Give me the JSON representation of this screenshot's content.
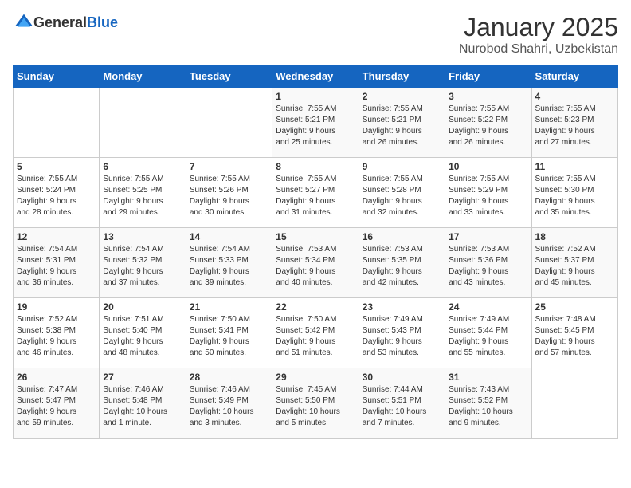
{
  "logo": {
    "general": "General",
    "blue": "Blue"
  },
  "title": "January 2025",
  "subtitle": "Nurobod Shahri, Uzbekistan",
  "headers": [
    "Sunday",
    "Monday",
    "Tuesday",
    "Wednesday",
    "Thursday",
    "Friday",
    "Saturday"
  ],
  "weeks": [
    [
      {
        "day": "",
        "info": ""
      },
      {
        "day": "",
        "info": ""
      },
      {
        "day": "",
        "info": ""
      },
      {
        "day": "1",
        "info": "Sunrise: 7:55 AM\nSunset: 5:21 PM\nDaylight: 9 hours\nand 25 minutes."
      },
      {
        "day": "2",
        "info": "Sunrise: 7:55 AM\nSunset: 5:21 PM\nDaylight: 9 hours\nand 26 minutes."
      },
      {
        "day": "3",
        "info": "Sunrise: 7:55 AM\nSunset: 5:22 PM\nDaylight: 9 hours\nand 26 minutes."
      },
      {
        "day": "4",
        "info": "Sunrise: 7:55 AM\nSunset: 5:23 PM\nDaylight: 9 hours\nand 27 minutes."
      }
    ],
    [
      {
        "day": "5",
        "info": "Sunrise: 7:55 AM\nSunset: 5:24 PM\nDaylight: 9 hours\nand 28 minutes."
      },
      {
        "day": "6",
        "info": "Sunrise: 7:55 AM\nSunset: 5:25 PM\nDaylight: 9 hours\nand 29 minutes."
      },
      {
        "day": "7",
        "info": "Sunrise: 7:55 AM\nSunset: 5:26 PM\nDaylight: 9 hours\nand 30 minutes."
      },
      {
        "day": "8",
        "info": "Sunrise: 7:55 AM\nSunset: 5:27 PM\nDaylight: 9 hours\nand 31 minutes."
      },
      {
        "day": "9",
        "info": "Sunrise: 7:55 AM\nSunset: 5:28 PM\nDaylight: 9 hours\nand 32 minutes."
      },
      {
        "day": "10",
        "info": "Sunrise: 7:55 AM\nSunset: 5:29 PM\nDaylight: 9 hours\nand 33 minutes."
      },
      {
        "day": "11",
        "info": "Sunrise: 7:55 AM\nSunset: 5:30 PM\nDaylight: 9 hours\nand 35 minutes."
      }
    ],
    [
      {
        "day": "12",
        "info": "Sunrise: 7:54 AM\nSunset: 5:31 PM\nDaylight: 9 hours\nand 36 minutes."
      },
      {
        "day": "13",
        "info": "Sunrise: 7:54 AM\nSunset: 5:32 PM\nDaylight: 9 hours\nand 37 minutes."
      },
      {
        "day": "14",
        "info": "Sunrise: 7:54 AM\nSunset: 5:33 PM\nDaylight: 9 hours\nand 39 minutes."
      },
      {
        "day": "15",
        "info": "Sunrise: 7:53 AM\nSunset: 5:34 PM\nDaylight: 9 hours\nand 40 minutes."
      },
      {
        "day": "16",
        "info": "Sunrise: 7:53 AM\nSunset: 5:35 PM\nDaylight: 9 hours\nand 42 minutes."
      },
      {
        "day": "17",
        "info": "Sunrise: 7:53 AM\nSunset: 5:36 PM\nDaylight: 9 hours\nand 43 minutes."
      },
      {
        "day": "18",
        "info": "Sunrise: 7:52 AM\nSunset: 5:37 PM\nDaylight: 9 hours\nand 45 minutes."
      }
    ],
    [
      {
        "day": "19",
        "info": "Sunrise: 7:52 AM\nSunset: 5:38 PM\nDaylight: 9 hours\nand 46 minutes."
      },
      {
        "day": "20",
        "info": "Sunrise: 7:51 AM\nSunset: 5:40 PM\nDaylight: 9 hours\nand 48 minutes."
      },
      {
        "day": "21",
        "info": "Sunrise: 7:50 AM\nSunset: 5:41 PM\nDaylight: 9 hours\nand 50 minutes."
      },
      {
        "day": "22",
        "info": "Sunrise: 7:50 AM\nSunset: 5:42 PM\nDaylight: 9 hours\nand 51 minutes."
      },
      {
        "day": "23",
        "info": "Sunrise: 7:49 AM\nSunset: 5:43 PM\nDaylight: 9 hours\nand 53 minutes."
      },
      {
        "day": "24",
        "info": "Sunrise: 7:49 AM\nSunset: 5:44 PM\nDaylight: 9 hours\nand 55 minutes."
      },
      {
        "day": "25",
        "info": "Sunrise: 7:48 AM\nSunset: 5:45 PM\nDaylight: 9 hours\nand 57 minutes."
      }
    ],
    [
      {
        "day": "26",
        "info": "Sunrise: 7:47 AM\nSunset: 5:47 PM\nDaylight: 9 hours\nand 59 minutes."
      },
      {
        "day": "27",
        "info": "Sunrise: 7:46 AM\nSunset: 5:48 PM\nDaylight: 10 hours\nand 1 minute."
      },
      {
        "day": "28",
        "info": "Sunrise: 7:46 AM\nSunset: 5:49 PM\nDaylight: 10 hours\nand 3 minutes."
      },
      {
        "day": "29",
        "info": "Sunrise: 7:45 AM\nSunset: 5:50 PM\nDaylight: 10 hours\nand 5 minutes."
      },
      {
        "day": "30",
        "info": "Sunrise: 7:44 AM\nSunset: 5:51 PM\nDaylight: 10 hours\nand 7 minutes."
      },
      {
        "day": "31",
        "info": "Sunrise: 7:43 AM\nSunset: 5:52 PM\nDaylight: 10 hours\nand 9 minutes."
      },
      {
        "day": "",
        "info": ""
      }
    ]
  ]
}
